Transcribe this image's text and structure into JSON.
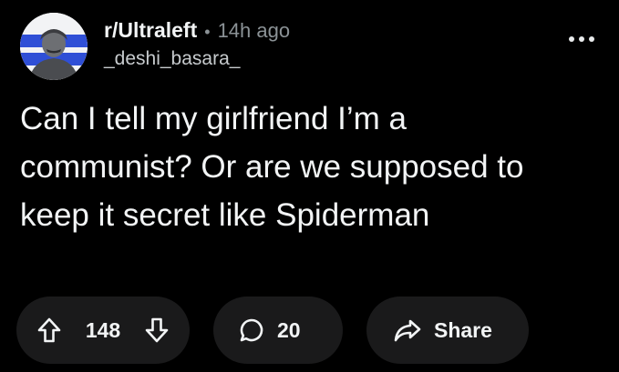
{
  "post": {
    "subreddit": "r/Ultraleft",
    "separator": "•",
    "time": "14h ago",
    "author": "_deshi_basara_",
    "title": "Can I tell my girlfriend I’m a communist? Or are we supposed to keep it secret like Spiderman"
  },
  "actions": {
    "score": "148",
    "comments": "20",
    "share_label": "Share"
  },
  "icons": {
    "avatar": "subreddit-avatar-portrait",
    "more": "more-dots-icon",
    "upvote": "upvote-arrow-icon",
    "downvote": "downvote-arrow-icon",
    "comment": "comment-bubble-icon",
    "share": "share-arrow-icon"
  },
  "colors": {
    "background": "#000000",
    "pill": "#1a1a1b",
    "text": "#f2f4f5",
    "muted": "#8b9296"
  }
}
